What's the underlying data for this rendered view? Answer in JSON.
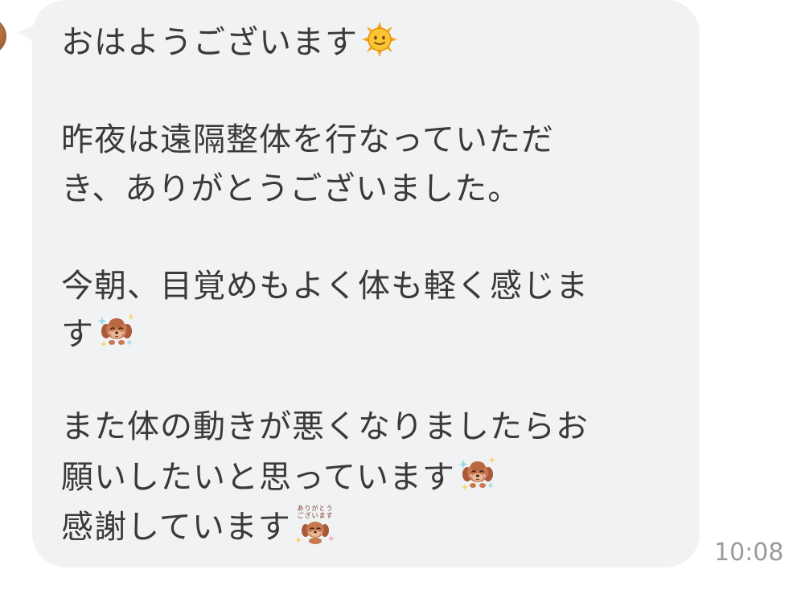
{
  "message": {
    "lines": [
      "おはようございます",
      "昨夜は遠隔整体を行なっていただ",
      "き、ありがとうございました。",
      "今朝、目覚めもよく体も軽く感じま",
      "す",
      "また体の動きが悪くなりましたらお",
      "願いしたいと思っています",
      "感謝しています"
    ],
    "emojis": {
      "line1": "sun-face-icon",
      "line5": "happy-dog-sparkle-sticker",
      "line7": "happy-dog-sparkle-sticker",
      "line8": "dog-thank-you-sticker"
    },
    "sticker_text": {
      "thank_you": "ありがとう ございます"
    },
    "timestamp": "10:08"
  },
  "colors": {
    "bubble_bg": "#f1f2f4",
    "text": "#3a3a3a",
    "timestamp": "#9b9b9b",
    "page_bg": "#ffffff"
  }
}
